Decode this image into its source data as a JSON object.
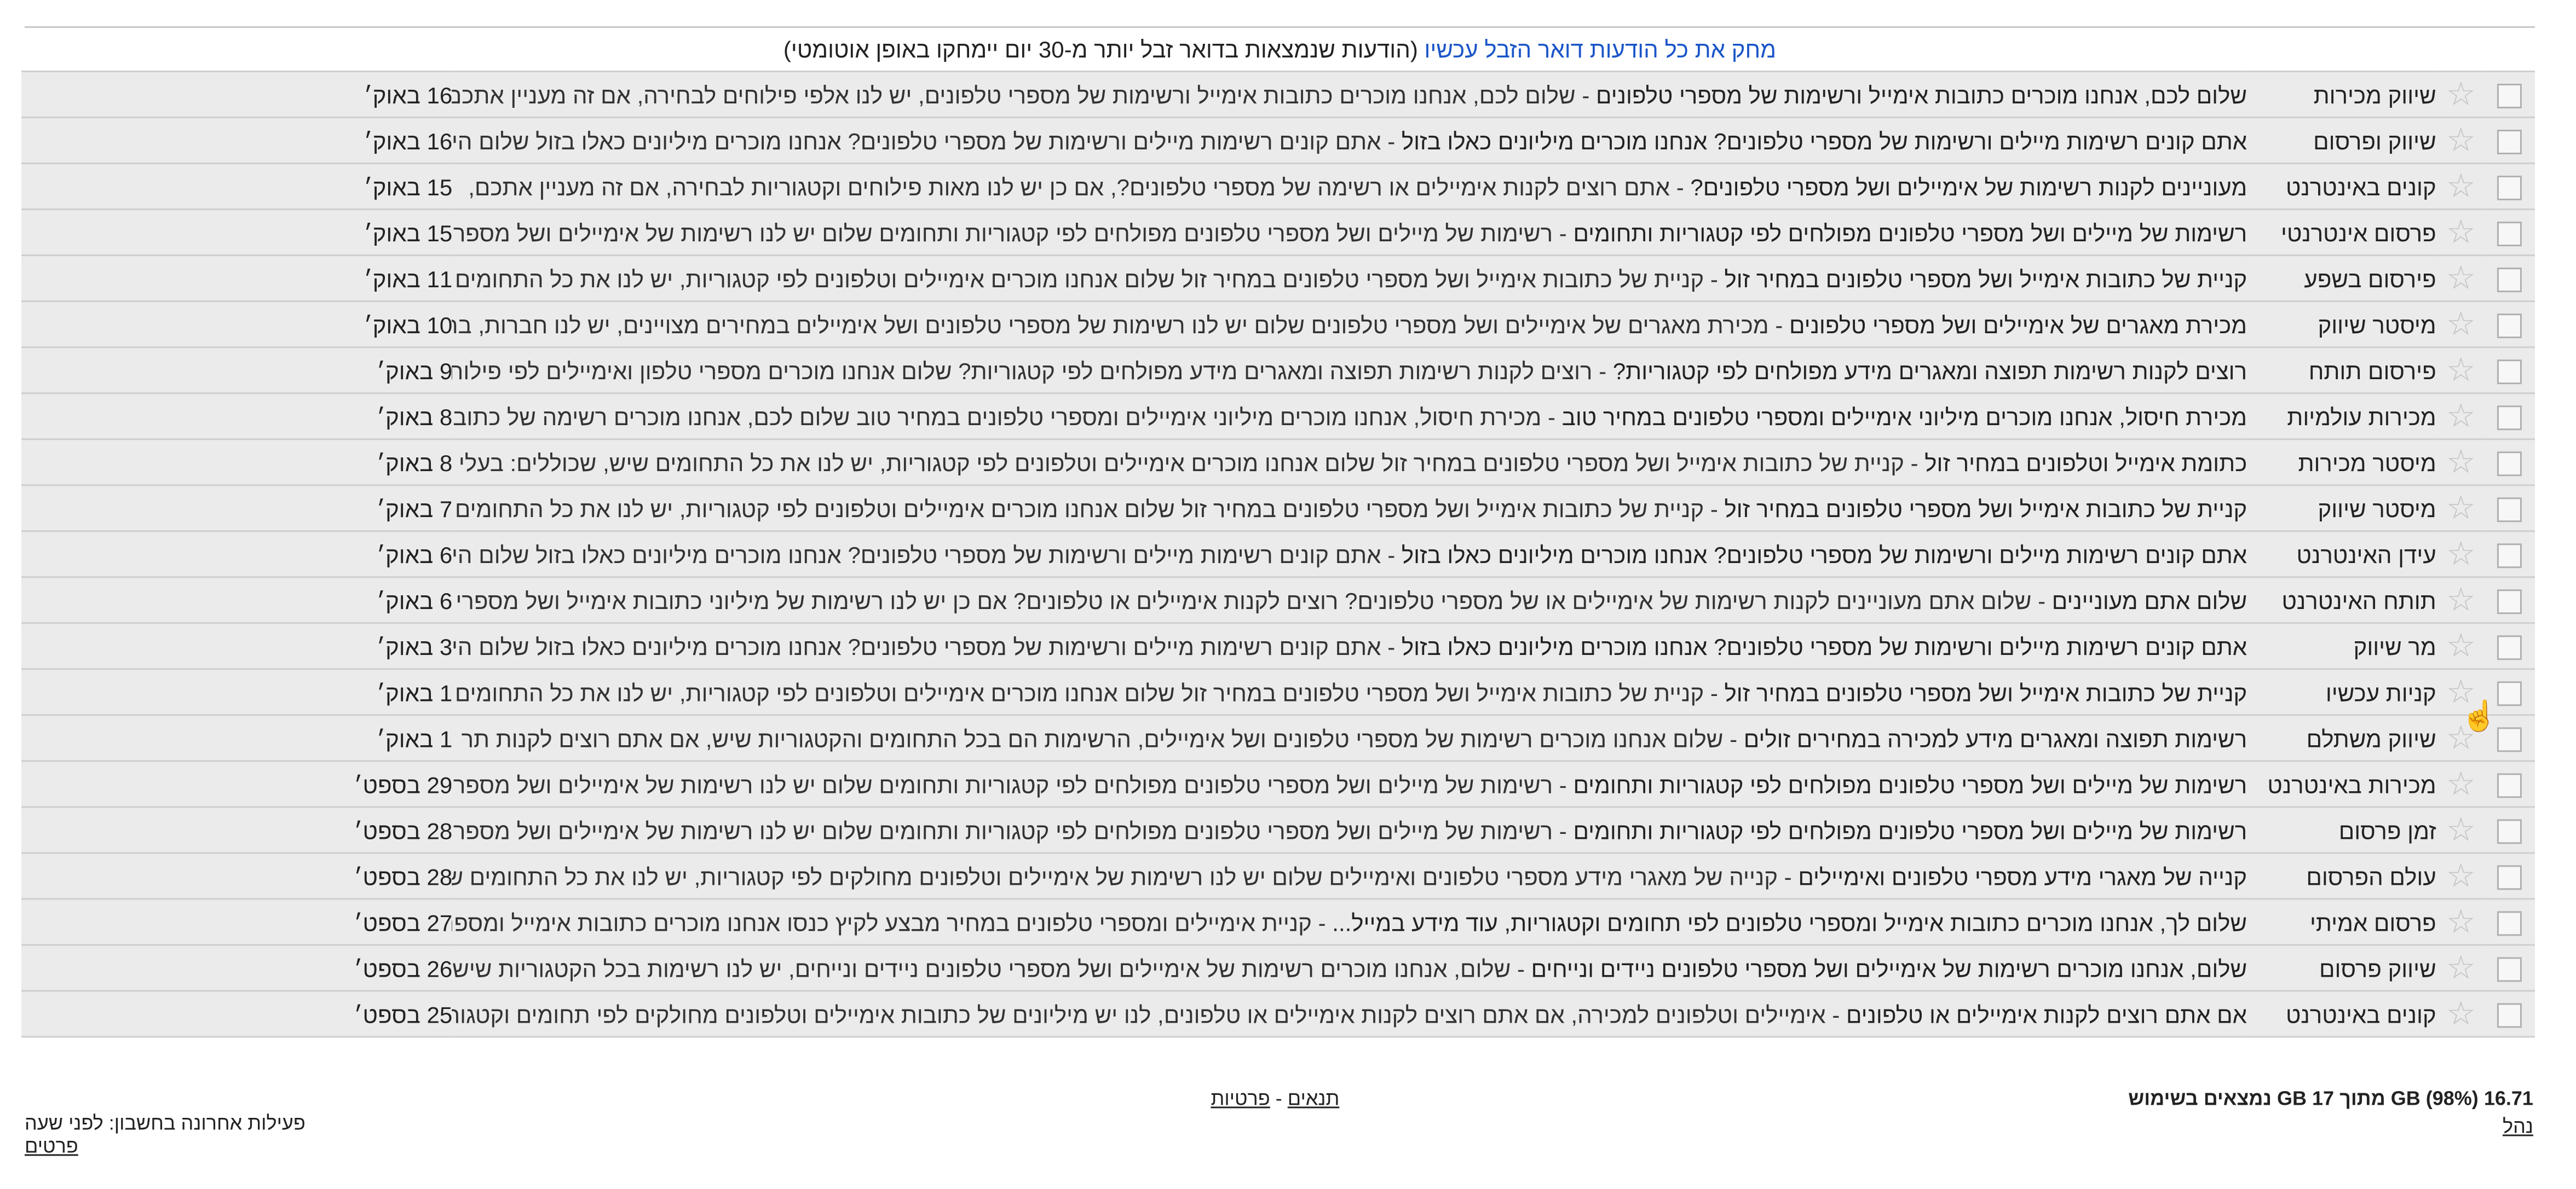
{
  "banner": {
    "link": "מחק את כל הודעות דואר הזבל עכשיו",
    "note": "(הודעות שנמצאות בדואר זבל יותר מ-30 יום יימחקו באופן אוטומטי)"
  },
  "icons": {
    "checkbox": "checkbox-icon",
    "star": "star-icon",
    "cursor": "hand-cursor-icon"
  },
  "messages": [
    {
      "from": "שיווק מכירות",
      "subject": "שלום לכם, אנחנו מוכרים כתובות אימייל ורשימות של מספרי טלפונים",
      "snippet": " - שלום לכם, אנחנו מוכרים כתובות אימייל ורשימות של מספרי טלפונים, יש לנו אלפי פילוחים לבחירה, אם זה מעניין אתכם",
      "date": "16 באוק׳"
    },
    {
      "from": "שיווק ופרסום",
      "subject": "אתם קונים רשימות מיילים ורשימות של מספרי טלפונים? אנחנו מוכרים מיליונים כאלו בזול",
      "snippet": " - אתם קונים רשימות מיילים ורשימות של מספרי טלפונים? אנחנו מוכרים מיליונים כאלו בזול שלום הי",
      "date": "16 באוק׳"
    },
    {
      "from": "קונים באינטרנט",
      "subject": "מעוניינים לקנות רשימות של אימיילים ושל מספרי טלפונים?",
      "snippet": " - אתם רוצים לקנות אימיילים או רשימה של מספרי טלפונים?, אם כן יש לנו מאות פילוחים וקטגוריות לבחירה, אם זה מעניין אתכם,",
      "date": "15 באוק׳"
    },
    {
      "from": "פרסום אינטרנטי",
      "subject": "רשימות של מיילים ושל מספרי טלפונים מפולחים לפי קטגוריות ותחומים",
      "snippet": " - רשימות של מיילים ושל מספרי טלפונים מפולחים לפי קטגוריות ותחומים שלום יש לנו רשימות של אימיילים ושל מספר",
      "date": "15 באוק׳"
    },
    {
      "from": "פירסום בשפע",
      "subject": "קניית של כתובות אימייל ושל מספרי טלפונים במחיר זול",
      "snippet": " - קניית של כתובות אימייל ושל מספרי טלפונים במחיר זול שלום אנחנו מוכרים אימיילים וטלפונים לפי קטגוריות, יש לנו את כל התחומים",
      "date": "11 באוק׳"
    },
    {
      "from": "מיסטר שיווק",
      "subject": "מכירת מאגרים של אימיילים ושל מספרי טלפונים",
      "snippet": " - מכירת מאגרים של אימיילים ושל מספרי טלפונים שלום יש לנו רשימות של מספרי טלפונים ושל אימיילים במחירים מצויינים, יש לנו חברות, בת",
      "date": "10 באוק׳"
    },
    {
      "from": "פירסום תותח",
      "subject": "רוצים לקנות רשימות תפוצה ומאגרים מידע מפולחים לפי קטגוריות?",
      "snippet": " - רוצים לקנות רשימות תפוצה ומאגרים מידע מפולחים לפי קטגוריות? שלום אנחנו מוכרים מספרי טלפון ואימיילים לפי פילוח",
      "date": "9 באוק׳"
    },
    {
      "from": "מכירות עולמיות",
      "subject": "מכירת חיסול, אנחנו מוכרים מיליוני אימיילים ומספרי טלפונים במחיר טוב",
      "snippet": " - מכירת חיסול, אנחנו מוכרים מיליוני אימיילים ומספרי טלפונים במחיר טוב שלום לכם, אנחנו מוכרים רשימה של כתובות",
      "date": "8 באוק׳"
    },
    {
      "from": "מיסטר מכירות",
      "subject": "כתומת אימייל וטלפונים במחיר זול",
      "snippet": " - קניית של כתובות אימייל ושל מספרי טלפונים במחיר זול שלום אנחנו מוכרים אימיילים וטלפונים לפי קטגוריות, יש לנו את כל התחומים שיש, שכוללים: בעלי",
      "date": "8 באוק׳"
    },
    {
      "from": "מיסטר שיווק",
      "subject": "קניית של כתובות אימייל ושל מספרי טלפונים במחיר זול",
      "snippet": " - קניית של כתובות אימייל ושל מספרי טלפונים במחיר זול שלום אנחנו מוכרים אימיילים וטלפונים לפי קטגוריות, יש לנו את כל התחומים",
      "date": "7 באוק׳"
    },
    {
      "from": "עידן האינטרנט",
      "subject": "אתם קונים רשימות מיילים ורשימות של מספרי טלפונים? אנחנו מוכרים מיליונים כאלו בזול",
      "snippet": " - אתם קונים רשימות מיילים ורשימות של מספרי טלפונים? אנחנו מוכרים מיליונים כאלו בזול שלום הי",
      "date": "6 באוק׳"
    },
    {
      "from": "תותח האינטרנט",
      "subject": "שלום אתם מעוניינים",
      "snippet": " - שלום אתם מעוניינים לקנות רשימות של אימיילים או של מספרי טלפונים? רוצים לקנות אימיילים או טלפונים? אם כן יש לנו רשימות של מיליוני כתובות אימייל ושל מספרי",
      "date": "6 באוק׳"
    },
    {
      "from": "מר שיווק",
      "subject": "אתם קונים רשימות מיילים ורשימות של מספרי טלפונים? אנחנו מוכרים מיליונים כאלו בזול",
      "snippet": " - אתם קונים רשימות מיילים ורשימות של מספרי טלפונים? אנחנו מוכרים מיליונים כאלו בזול שלום הי",
      "date": "3 באוק׳"
    },
    {
      "from": "קניות עכשיו",
      "subject": "קניית של כתובות אימייל ושל מספרי טלפונים במחיר זול",
      "snippet": " - קניית של כתובות אימייל ושל מספרי טלפונים במחיר זול שלום אנחנו מוכרים אימיילים וטלפונים לפי קטגוריות, יש לנו את כל התחומים",
      "date": "1 באוק׳"
    },
    {
      "from": "שיווק משתלם",
      "subject": "רשימות תפוצה ומאגרים מידע למכירה במחירים זולים",
      "snippet": " - שלום אנחנו מוכרים רשימות של מספרי טלפונים ושל אימיילים, הרשימות הם בכל התחומים והקטגוריות שיש, אם אתם רוצים לקנות תר",
      "date": "1 באוק׳"
    },
    {
      "from": "מכירות באינטרנט",
      "subject": "רשימות של מיילים ושל מספרי טלפונים מפולחים לפי קטגוריות ותחומים",
      "snippet": " - רשימות של מיילים ושל מספרי טלפונים מפולחים לפי קטגוריות ותחומים שלום יש לנו רשימות של אימיילים ושל מספר",
      "date": "29 בספט׳"
    },
    {
      "from": "זמן פרסום",
      "subject": "רשימות של מיילים ושל מספרי טלפונים מפולחים לפי קטגוריות ותחומים",
      "snippet": " - רשימות של מיילים ושל מספרי טלפונים מפולחים לפי קטגוריות ותחומים שלום יש לנו רשימות של אימיילים ושל מספר",
      "date": "28 בספט׳"
    },
    {
      "from": "עולם הפרסום",
      "subject": "קנייה של מאגרי מידע מספרי טלפונים ואימיילים",
      "snippet": " - קנייה של מאגרי מידע מספרי טלפונים ואימיילים שלום יש לנו רשימות של אימיילים וטלפונים מחולקים לפי קטגוריות, יש לנו את כל התחומים ש",
      "date": "28 בספט׳"
    },
    {
      "from": "פרסום אמיתי",
      "subject": "שלום לך, אנחנו מוכרים כתובות אימייל ומספרי טלפונים לפי תחומים וקטגוריות, עוד מידע במייל...",
      "snippet": " - קניית אימיילים ומספרי טלפונים במחיר מבצע לקיץ כנסו אנחנו מוכרים כתובות אימייל ומספר",
      "date": "27 בספט׳"
    },
    {
      "from": "שיווק פרסום",
      "subject": "שלום, אנחנו מוכרים רשימות של אימיילים ושל מספרי טלפונים ניידים ונייחים",
      "snippet": " - שלום, אנחנו מוכרים רשימות של אימיילים ושל מספרי טלפונים ניידים ונייחים, יש לנו רשימות בכל הקטגוריות שיש",
      "date": "26 בספט׳"
    },
    {
      "from": "קונים באינטרנט",
      "subject": "אם אתם רוצים לקנות אימיילים או טלפונים",
      "snippet": " - אימיילים וטלפונים למכירה, אם אתם רוצים לקנות אימיילים או טלפונים, לנו יש מיליונים של כתובות אימיילים וטלפונים מחולקים לפי תחומים וקטגור",
      "date": "25 בספט׳"
    }
  ],
  "footer": {
    "usage": "16.71 GB (98%) מתוך 17 GB נמצאים בשימוש",
    "manage": "נהל",
    "terms": "תנאים",
    "separator": " - ",
    "privacy": "פרטיות",
    "last_activity": "פעילות אחרונה בחשבון: לפני שעה",
    "details": "פרטים"
  }
}
